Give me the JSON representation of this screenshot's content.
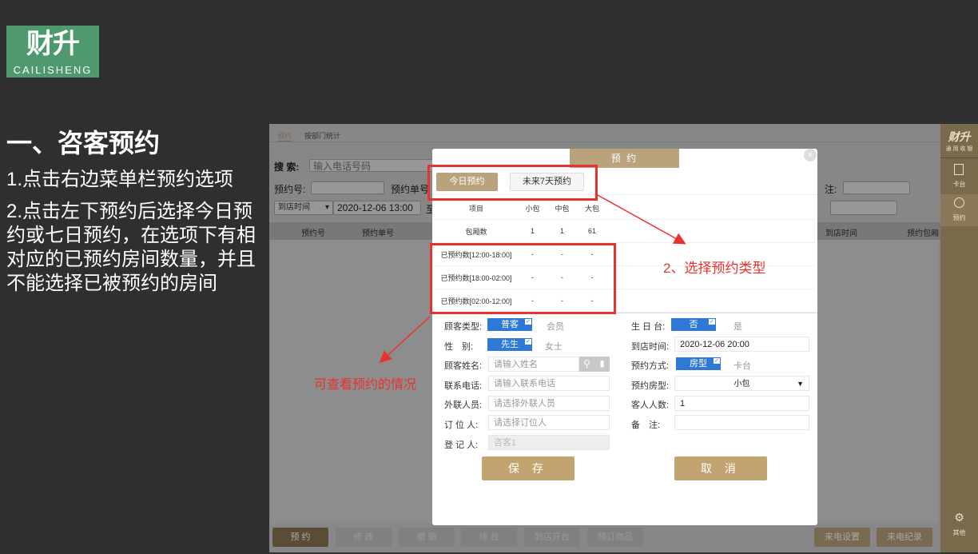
{
  "logo": {
    "big": "财升",
    "small": "CAILISHENG"
  },
  "instructions": {
    "heading": "一、咨客预约",
    "step1": "1.点击右边菜单栏预约选项",
    "step2": "2.点击左下预约后选择今日预约或七日预约，在选项下有相对应的已预约房间数量，并且不能选择已被预约的房间"
  },
  "app": {
    "tabs": [
      "预约",
      "按部门统计"
    ],
    "search_label": "搜 索:",
    "search_placeholder": "输入电话号码",
    "resv_no_label": "预约号:",
    "resv_order_label": "预约单号",
    "arrival_filter": "到店时间",
    "date_value": "2020-12-06 13:00",
    "to_label": "至",
    "note_label": "注:",
    "table_headers": [
      "预约号",
      "预约单号",
      "到店时间",
      "预约包厢"
    ],
    "bottom_buttons": [
      "预 约",
      "修 改",
      "撤 销",
      "排 台",
      "到店开台",
      "预订商品"
    ],
    "right_buttons": [
      "来电设置",
      "来电纪录"
    ]
  },
  "sidebar": {
    "brand": "财升",
    "brand_sub": "通 用 收 银",
    "items": [
      {
        "label": "卡台",
        "icon": "card-icon"
      },
      {
        "label": "预约",
        "icon": "clock-icon"
      },
      {
        "label": "其他",
        "icon": "gear-icon"
      }
    ]
  },
  "modal": {
    "title": "预 约",
    "close": "×",
    "tab_today": "今日预约",
    "tab_7days": "未来7天预约",
    "table": {
      "headers": [
        "项目",
        "小包",
        "中包",
        "大包"
      ],
      "rows": [
        [
          "包厢数",
          "1",
          "1",
          "61"
        ],
        [
          "已预约数[12:00-18:00]",
          "-",
          "-",
          "-"
        ],
        [
          "已预约数[18:00-02:00]",
          "-",
          "-",
          "-"
        ],
        [
          "已预约数[02:00-12:00]",
          "-",
          "-",
          "-"
        ]
      ]
    },
    "form": {
      "customer_type_label": "顾客类型:",
      "customer_type_on": "普客",
      "customer_type_off": "会员",
      "gender_label": "性　别:",
      "gender_on": "先生",
      "gender_off": "女士",
      "name_label": "顾客姓名:",
      "name_placeholder": "请输入姓名",
      "phone_label": "联系电话:",
      "phone_placeholder": "请输入联系电话",
      "outsider_label": "外联人员:",
      "outsider_placeholder": "请选择外联人员",
      "booker_label": "订 位 人:",
      "booker_placeholder": "请选择订位人",
      "register_label": "登 记 人:",
      "register_value": "咨客1",
      "birthday_label": "生 日 台:",
      "birthday_on": "否",
      "birthday_off": "是",
      "arrival_label": "到店时间:",
      "arrival_value": "2020-12-06 20:00",
      "method_label": "预约方式:",
      "method_on": "房型",
      "method_off": "卡台",
      "room_type_label": "预约房型:",
      "room_type_value": "小包",
      "guests_label": "客人人数:",
      "guests_value": "1",
      "remark_label": "备　注:",
      "save": "保 存",
      "cancel": "取 消"
    }
  },
  "annotations": {
    "choose_type": "2、选择预约类型",
    "view_status": "可查看预约的情况"
  },
  "colors": {
    "accent": "#b9a27c",
    "annotation": "#e8322f",
    "toggle": "#2e78d6"
  }
}
